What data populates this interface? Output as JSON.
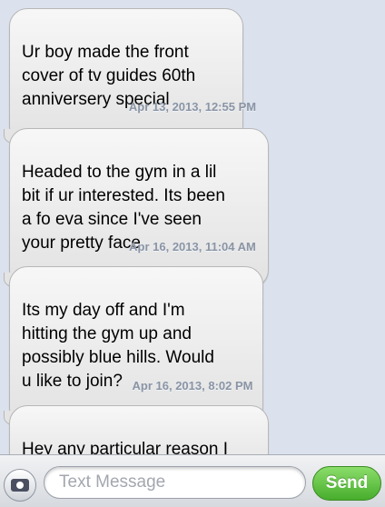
{
  "messages": [
    {
      "text": "Ur boy made the front\ncover of tv guides 60th\nanniversery special"
    },
    {
      "text": "Headed to the gym in a lil\nbit if ur interested. Its been\na fo eva since I've seen\nyour pretty face"
    },
    {
      "text": "Its my day off and I'm\nhitting the gym up and\npossibly blue hills. Would\nu like to join?"
    },
    {
      "text": "Hey any particular reason I\nhaven't heard back from"
    }
  ],
  "timestamps": [
    "Apr 13, 2013, 12:55 PM",
    "Apr 16, 2013, 11:04 AM",
    "Apr 16, 2013, 8:02 PM"
  ],
  "input_bar": {
    "placeholder": "Text Message",
    "send_label": "Send",
    "camera_icon": "camera-icon",
    "send_color": "#47ad2c"
  }
}
